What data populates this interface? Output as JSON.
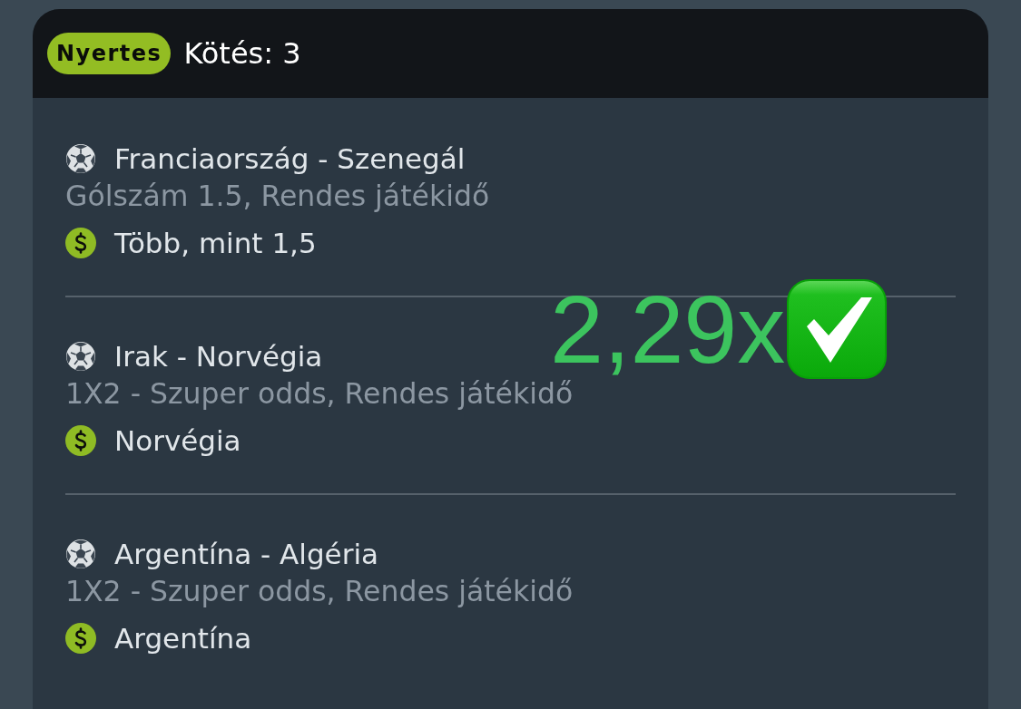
{
  "header": {
    "status_badge": "Nyertes",
    "title": "Kötés: 3"
  },
  "selections": [
    {
      "event": "Franciaország - Szenegál",
      "market": "Gólszám 1.5, Rendes játékidő",
      "pick": "Több, mint 1,5"
    },
    {
      "event": "Irak - Norvégia",
      "market": "1X2 - Szuper odds, Rendes játékidő",
      "pick": "Norvégia"
    },
    {
      "event": "Argentína - Algéria",
      "market": "1X2 - Szuper odds, Rendes játékidő",
      "pick": "Argentína"
    }
  ],
  "odds_sticker": {
    "text": "2,29x"
  }
}
